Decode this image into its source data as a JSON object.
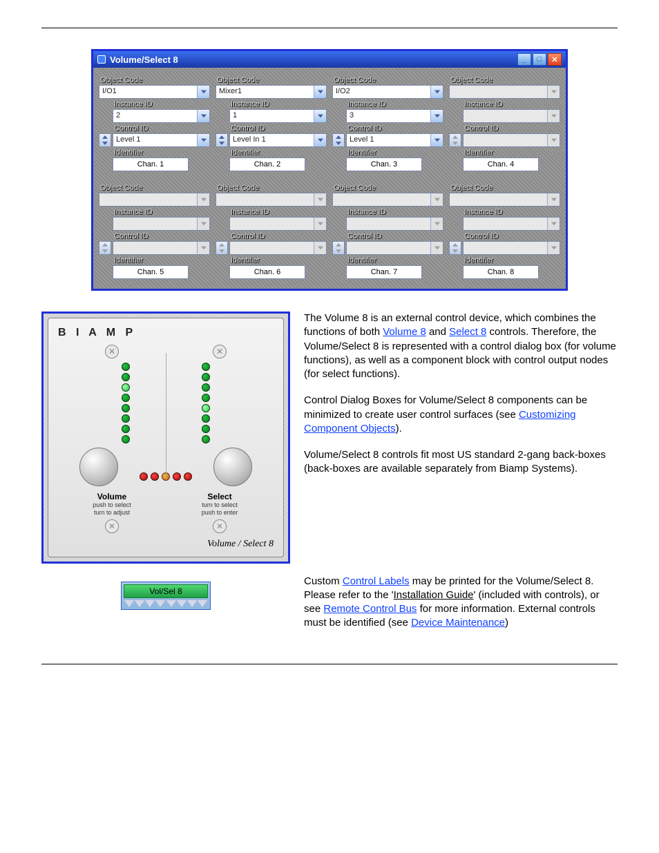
{
  "dialog": {
    "title": "Volume/Select 8",
    "labels": {
      "objcode": "Object Code",
      "instance": "Instance ID",
      "control": "Control ID",
      "identifier": "Identifier"
    },
    "cols": [
      {
        "obj": "I/O1",
        "inst": "2",
        "ctrl": "Level 1",
        "ident": "Chan. 1",
        "active": true
      },
      {
        "obj": "Mixer1",
        "inst": "1",
        "ctrl": "Level In 1",
        "ident": "Chan. 2",
        "active": true
      },
      {
        "obj": "I/O2",
        "inst": "3",
        "ctrl": "Level 1",
        "ident": "Chan. 3",
        "active": true
      },
      {
        "obj": "",
        "inst": "",
        "ctrl": "",
        "ident": "Chan. 4",
        "active": false
      },
      {
        "obj": "",
        "inst": "",
        "ctrl": "",
        "ident": "Chan. 5",
        "active": false
      },
      {
        "obj": "",
        "inst": "",
        "ctrl": "",
        "ident": "Chan. 6",
        "active": false
      },
      {
        "obj": "",
        "inst": "",
        "ctrl": "",
        "ident": "Chan. 7",
        "active": false
      },
      {
        "obj": "",
        "inst": "",
        "ctrl": "",
        "ident": "Chan. 8",
        "active": false
      }
    ]
  },
  "panel": {
    "brand": "B I A M P",
    "vol_label": "Volume",
    "vol_sub": "push to select\nturn to adjust",
    "sel_label": "Select",
    "sel_sub": "turn to select\npush to enter",
    "caption": "Volume / Select 8"
  },
  "block": {
    "label": "Vol/Sel 8"
  },
  "text": {
    "p1a": "The Volume 8 is an external control device, which combines the functions of both ",
    "p1_link1": "Volume 8",
    "p1b": " and ",
    "p1_link2": "Select 8",
    "p1c": " controls. Therefore, the Volume/Select 8 is represented with a control dialog box (for volume functions), as well as a component block with control output nodes (for select functions).",
    "p2a": "Control Dialog Boxes for Volume/Select 8 components can be minimized to create user control surfaces (see ",
    "p2_link": "Customizing Component Objects",
    "p2b": ").",
    "p3": "Volume/Select 8 controls fit most US standard 2-gang back-boxes (back-boxes are available separately from Biamp Systems).",
    "p4a": "Custom ",
    "p4_link1": "Control Labels",
    "p4b": " may be printed for the Volume/Select 8. Please refer to the '",
    "p4_u": "Installation Guide",
    "p4c": "' (included with controls), or see ",
    "p4_link2": "Remote Control Bus",
    "p4d": " for more information. External controls must be identified (see ",
    "p4_link3": "Device Maintenance",
    "p4e": ")"
  }
}
